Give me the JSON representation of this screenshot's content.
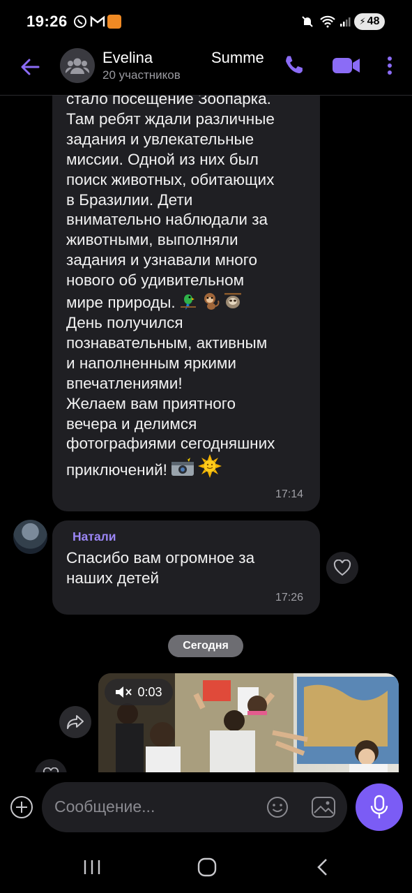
{
  "status_bar": {
    "time": "19:26",
    "battery": "48"
  },
  "header": {
    "title": "Evelina",
    "title_2": "Summe",
    "participants": "20 участников"
  },
  "messages": [
    {
      "id": "msg1",
      "text": "стало посещение Зоопарка.\nТам ребят ждали различные\nзадания и увлекательные\nмиссии. Одной из них был\nпоиск животных, обитающих\nв Бразилии. Дети\nвнимательно наблюдали за\nживотными, выполняли\nзадания и узнавали много\nнового об удивительном",
      "text_line_11": "мире природы.",
      "emoji_1": "parrot-emoji, monkey-emoji, sloth-emoji",
      "text_2": "День получился\nпознавательным, активным\nи наполненным яркими\nвпечатлениями!\nЖелаем вам приятного\nвечера и делимся\nфотографиями сегодняшних",
      "text_last": "приключений!",
      "emoji_2": "camera-flash-emoji, sun-emoji",
      "time": "17:14"
    },
    {
      "id": "msg2",
      "sender": "Натали",
      "text": "Спасибо  вам огромное за наших детей",
      "time": "17:26"
    }
  ],
  "date_separator": "Сегодня",
  "video": {
    "duration": "0:03",
    "muted": true
  },
  "composer": {
    "placeholder": "Сообщение..."
  },
  "colors": {
    "accent": "#7b5cf5",
    "sender": "#9b86f5",
    "bubble": "#1f1f23"
  }
}
